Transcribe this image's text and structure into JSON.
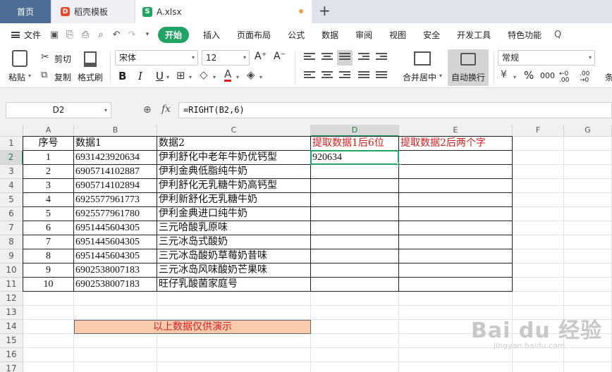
{
  "tabs": [
    {
      "label": "首页"
    },
    {
      "label": "稻壳模板"
    },
    {
      "label": "A.xlsx"
    }
  ],
  "menu": {
    "file": "文件",
    "items": [
      "开始",
      "插入",
      "页面布局",
      "公式",
      "数据",
      "审阅",
      "视图",
      "安全",
      "开发工具",
      "特色功能"
    ]
  },
  "toolbar": {
    "paste": "粘贴",
    "cut": "剪切",
    "copy": "复制",
    "format_painter": "格式刷",
    "font_name": "宋体",
    "font_size": "12",
    "merge_center": "合并居中",
    "auto_wrap": "自动换行",
    "number_format": "常规",
    "increase_font": "A⁺",
    "decrease_font": "A⁻",
    "bold": "B",
    "italic": "I",
    "underline": "U",
    "font_color": "A",
    "percent": "%",
    "comma": "000",
    "inc_decimal": "←0 .00",
    "dec_decimal": ".00 →0",
    "more": "条"
  },
  "formula_bar": {
    "name_box": "D2",
    "fx": "fx",
    "formula": "=RIGHT(B2,6)"
  },
  "columns": [
    "A",
    "B",
    "C",
    "D",
    "E",
    "F",
    "G"
  ],
  "rows": [
    "1",
    "2",
    "3",
    "4",
    "5",
    "6",
    "7",
    "8",
    "9",
    "10",
    "11",
    "12",
    "13",
    "14",
    "15",
    "16",
    "17"
  ],
  "header_row": {
    "a": "序号",
    "b": "数据1",
    "c": "数据2",
    "d": "提取数据1后6位",
    "e": "提取数据2后两个字"
  },
  "table_rows": [
    {
      "no": "1",
      "data1": "6931423920634",
      "data2": "伊利舒化中老年牛奶优钙型",
      "d": "920634"
    },
    {
      "no": "2",
      "data1": "6905714102887",
      "data2": "伊利金典低脂纯牛奶",
      "d": ""
    },
    {
      "no": "3",
      "data1": "6905714102894",
      "data2": "伊利舒化无乳糖牛奶高钙型",
      "d": ""
    },
    {
      "no": "4",
      "data1": "6925577961773",
      "data2": "伊利新舒化无乳糖牛奶",
      "d": ""
    },
    {
      "no": "5",
      "data1": "6925577961780",
      "data2": "伊利金典进口纯牛奶",
      "d": ""
    },
    {
      "no": "6",
      "data1": "6951445604305",
      "data2": "三元哈酸乳原味",
      "d": ""
    },
    {
      "no": "7",
      "data1": "6951445604305",
      "data2": "三元冰岛式酸奶",
      "d": ""
    },
    {
      "no": "8",
      "data1": "6951445604305",
      "data2": "三元冰岛酸奶草莓奶昔味",
      "d": ""
    },
    {
      "no": "9",
      "data1": "6902538007183",
      "data2": "三元冰岛风味酸奶芒果味",
      "d": ""
    },
    {
      "no": "10",
      "data1": "6902538007183",
      "data2": "旺仔乳酸菌家庭号",
      "d": ""
    }
  ],
  "note": "以上数据仅供演示",
  "watermark": {
    "main": "Bai du 经验",
    "sub": "jingyan.baidu.com"
  },
  "colors": {
    "accent": "#21a366",
    "header_red": "#d81e1e",
    "note_fill": "#f8cbad",
    "home_tab": "#4d6f96"
  }
}
